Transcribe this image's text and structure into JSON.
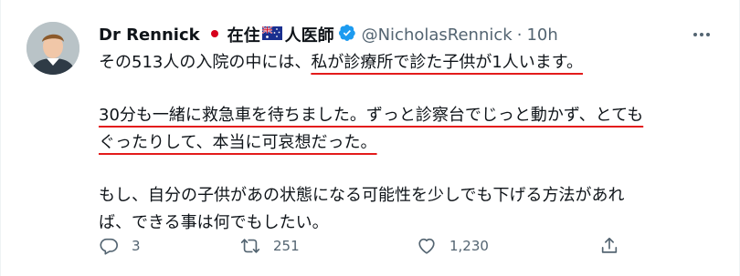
{
  "tweet": {
    "author": {
      "name": "Dr Rennick",
      "name_suffix": "在住",
      "name_suffix2": "人医師",
      "flag1_icon": "japan-flag-icon",
      "flag2_icon": "australia-flag-icon",
      "verified_icon": "verified-badge-icon",
      "handle": "@NicholasRennick",
      "separator": "·",
      "time": "10h"
    },
    "more_icon": "more-horizontal-icon",
    "body": {
      "line1_plain": "その513人の入院の中には、",
      "line1_underlined": "私が診療所で診た子供が1人います。",
      "line2_underlined": "30分も一緒に救急車を待ちました。ずっと診察台でじっと動かず、とても",
      "line3_underlined": "ぐったりして、本当に可哀想だった。",
      "line4": "もし、自分の子供があの状態になる可能性を少しでも下げる方法があれ",
      "line5": "ば、できる事は何でもしたい。"
    },
    "actions": {
      "reply": {
        "icon": "reply-icon",
        "count": "3"
      },
      "retweet": {
        "icon": "retweet-icon",
        "count": "251"
      },
      "like": {
        "icon": "heart-icon",
        "count": "1,230"
      },
      "share": {
        "icon": "share-icon"
      }
    },
    "colors": {
      "text": "#0f1419",
      "secondary": "#536471",
      "verified": "#1d9bf0",
      "annotation_underline": "#e31b1b"
    }
  }
}
